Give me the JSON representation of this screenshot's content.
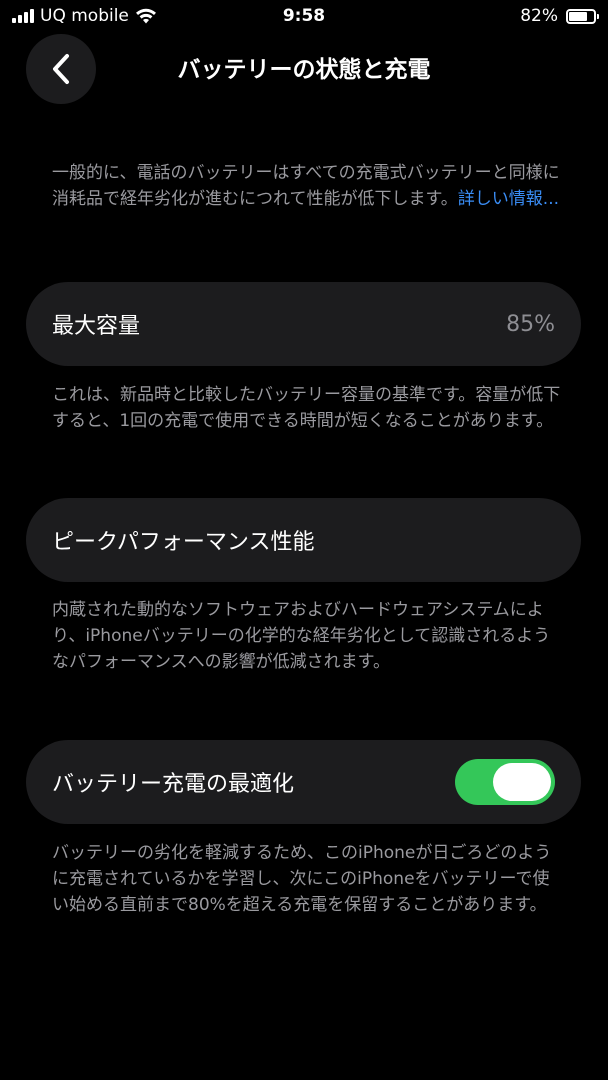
{
  "status_bar": {
    "carrier": "UQ mobile",
    "time": "9:58",
    "battery_percent": "82%",
    "battery_level": 0.82
  },
  "header": {
    "title": "バッテリーの状態と充電"
  },
  "intro": {
    "text": "一般的に、電話のバッテリーはすべての充電式バッテリーと同様に消耗品で経年劣化が進むにつれて性能が低下します。",
    "link": "詳しい情報..."
  },
  "max_capacity": {
    "label": "最大容量",
    "value": "85%",
    "description": "これは、新品時と比較したバッテリー容量の基準です。容量が低下すると、1回の充電で使用できる時間が短くなることがあります。"
  },
  "peak_performance": {
    "label": "ピークパフォーマンス性能",
    "description": "内蔵された動的なソフトウェアおよびハードウェアシステムにより、iPhoneバッテリーの化学的な経年劣化として認識されるようなパフォーマンスへの影響が低減されます。"
  },
  "optimized_charging": {
    "label": "バッテリー充電の最適化",
    "enabled": true,
    "description": "バッテリーの劣化を軽減するため、このiPhoneが日ごろどのように充電されているかを学習し、次にこのiPhoneをバッテリーで使い始める直前まで80%を超える充電を保留することがあります。"
  },
  "colors": {
    "background": "#000000",
    "card": "#1c1c1e",
    "link": "#3a8df5",
    "toggle_on": "#34c759",
    "secondary_text": "#9a9a9f"
  }
}
